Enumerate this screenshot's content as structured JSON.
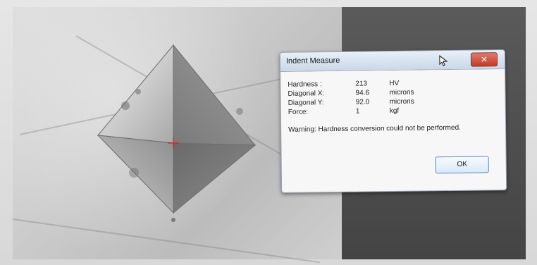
{
  "dialog": {
    "title": "Indent Measure",
    "close_label": "✕",
    "measurements": [
      {
        "label": "Hardness :",
        "value": "213",
        "unit": "HV"
      },
      {
        "label": "Diagonal X:",
        "value": "94.6",
        "unit": "microns"
      },
      {
        "label": "Diagonal Y:",
        "value": "92.0",
        "unit": "microns"
      },
      {
        "label": "Force:",
        "value": "1",
        "unit": "kgf"
      }
    ],
    "warning": "Warning: Hardness conversion could not be performed.",
    "ok_label": "OK"
  },
  "icons": {
    "close": "close-icon",
    "cursor": "mouse-pointer-icon"
  },
  "colors": {
    "dialog_bg": "#f7f7f7",
    "titlebar": "#c9d8e8",
    "close": "#c33a2a",
    "ok_border": "#4a8ad8",
    "crosshair": "#d11"
  }
}
